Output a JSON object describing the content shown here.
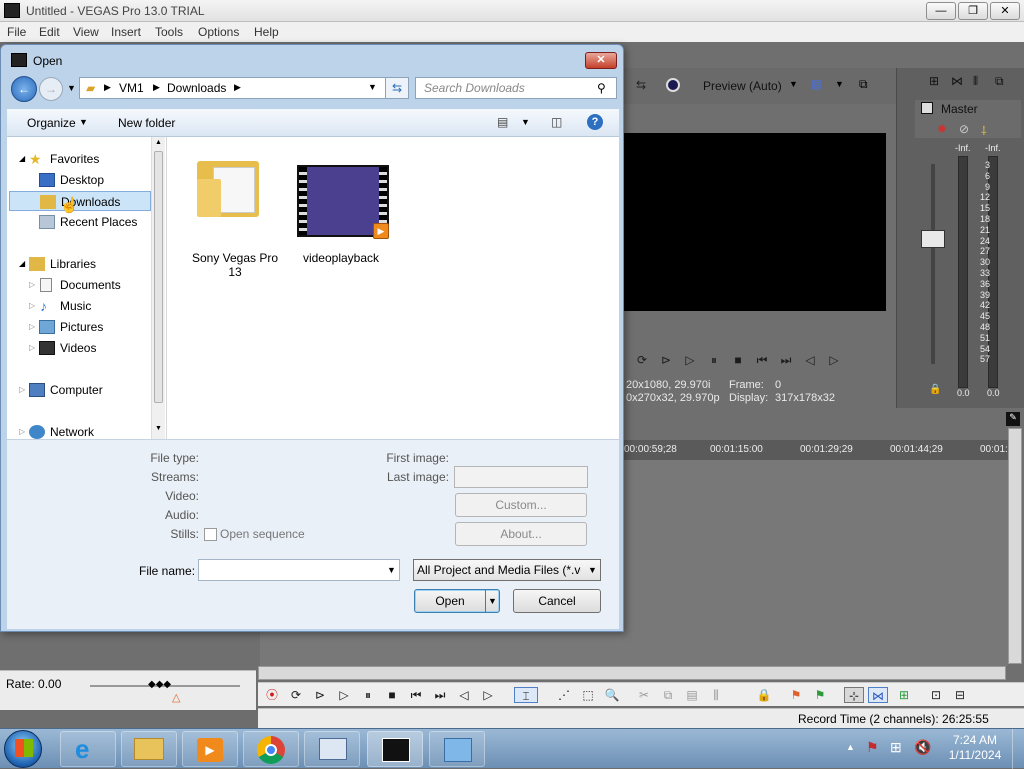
{
  "app": {
    "title": "Untitled - VEGAS Pro 13.0 TRIAL",
    "menu": [
      "File",
      "Edit",
      "View",
      "Insert",
      "Tools",
      "Options",
      "Help"
    ],
    "preview_mode": "Preview (Auto)",
    "preview_info": {
      "project_line": "20x1080, 29.970i",
      "preview_line": "0x270x32, 29.970p",
      "frame_label": "Frame:",
      "frame_value": "0",
      "display_label": "Display:",
      "display_value": "317x178x32"
    },
    "mixer": {
      "title": "Master",
      "inf_left": "-Inf.",
      "inf_right": "-Inf.",
      "ticks": [
        "3",
        "6",
        "9",
        "12",
        "15",
        "18",
        "21",
        "24",
        "27",
        "30",
        "33",
        "36",
        "39",
        "42",
        "45",
        "48",
        "51",
        "54",
        "57"
      ],
      "bottom_left": "0.0",
      "bottom_right": "0.0"
    },
    "ruler": [
      "00:00:59;28",
      "00:01:15:00",
      "00:01:29;29",
      "00:01:44;29",
      "00:01:5"
    ],
    "rate": "Rate: 0.00",
    "record_time": "Record Time (2 channels): 26:25:55"
  },
  "dialog": {
    "title": "Open",
    "breadcrumb": [
      "VM1",
      "Downloads"
    ],
    "search_placeholder": "Search Downloads",
    "organize": "Organize",
    "new_folder": "New folder",
    "nav": {
      "favorites": "Favorites",
      "desktop": "Desktop",
      "downloads": "Downloads",
      "recent": "Recent Places",
      "libraries": "Libraries",
      "documents": "Documents",
      "music": "Music",
      "pictures": "Pictures",
      "videos": "Videos",
      "computer": "Computer",
      "network": "Network"
    },
    "files": [
      {
        "name_line1": "Sony Vegas Pro",
        "name_line2": "13",
        "icon": "folder-icon"
      },
      {
        "name_line1": "videoplayback",
        "name_line2": "",
        "icon": "video-file-icon"
      }
    ],
    "details": {
      "file_type": "File type:",
      "streams": "Streams:",
      "video": "Video:",
      "audio": "Audio:",
      "stills": "Stills:",
      "open_sequence": "Open sequence",
      "first_image": "First image:",
      "last_image": "Last image:",
      "custom": "Custom...",
      "about": "About..."
    },
    "file_name_label": "File name:",
    "file_name_value": "",
    "file_type_filter": "All Project and Media Files (*.ve",
    "open": "Open",
    "cancel": "Cancel"
  },
  "taskbar": {
    "time": "7:24 AM",
    "date": "1/11/2024"
  },
  "colors": {
    "dialog_frame": "#bcd3ea",
    "selection": "#cce4f7",
    "taskbar": "#7f9fc2"
  }
}
